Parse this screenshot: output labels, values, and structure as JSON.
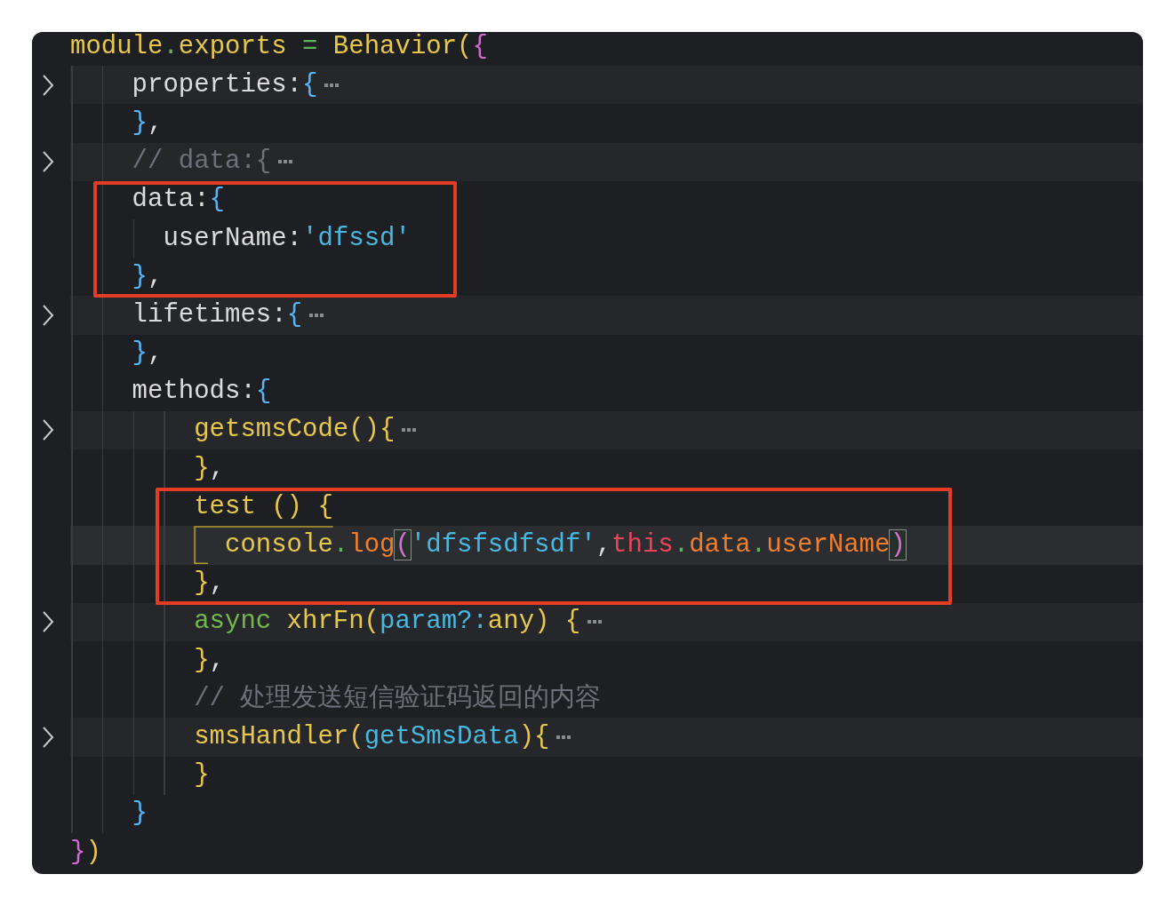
{
  "editor": {
    "lines": [
      {
        "tokens": [
          {
            "text": "module",
            "kind": "func"
          },
          {
            "text": ".",
            "kind": "op"
          },
          {
            "text": "exports ",
            "kind": "func"
          },
          {
            "text": "=",
            "kind": "op"
          },
          {
            "text": " Behavior(",
            "kind": "func"
          },
          {
            "text": "{",
            "kind": "brace-pink"
          }
        ],
        "folded": false,
        "current": false,
        "boxed": false,
        "bracket_guide": false,
        "children": [
          {
            "tokens": [
              {
                "text": "properties:",
                "kind": "plain"
              },
              {
                "text": "{",
                "kind": "brace-blue"
              }
            ],
            "folded": true,
            "current": false,
            "boxed": false,
            "bracket_guide": false
          },
          {
            "tokens": [
              {
                "text": "}",
                "kind": "brace-blue"
              },
              {
                "text": ",",
                "kind": "plain"
              }
            ],
            "folded": false,
            "current": false,
            "boxed": false,
            "bracket_guide": false
          },
          {
            "tokens": [
              {
                "text": "// data:{",
                "kind": "comment"
              }
            ],
            "folded": true,
            "current": false,
            "boxed": false,
            "bracket_guide": false
          },
          {
            "tokens": [
              {
                "text": "data:",
                "kind": "plain"
              },
              {
                "text": "{",
                "kind": "brace-blue"
              }
            ],
            "folded": false,
            "current": false,
            "boxed": true,
            "bracket_guide": false,
            "children": [
              {
                "tokens": [
                  {
                    "text": "userName:",
                    "kind": "plain"
                  },
                  {
                    "text": "'dfssd'",
                    "kind": "string"
                  }
                ],
                "folded": false,
                "current": false,
                "boxed": true,
                "bracket_guide": false
              }
            ]
          },
          {
            "tokens": [
              {
                "text": "}",
                "kind": "brace-blue"
              },
              {
                "text": ",",
                "kind": "plain"
              }
            ],
            "folded": false,
            "current": false,
            "boxed": true,
            "bracket_guide": false
          },
          {
            "tokens": [
              {
                "text": "lifetimes:",
                "kind": "plain"
              },
              {
                "text": "{",
                "kind": "brace-blue"
              }
            ],
            "folded": true,
            "current": false,
            "boxed": false,
            "bracket_guide": false
          },
          {
            "tokens": [
              {
                "text": "}",
                "kind": "brace-blue"
              },
              {
                "text": ",",
                "kind": "plain"
              }
            ],
            "folded": false,
            "current": false,
            "boxed": false,
            "bracket_guide": false
          },
          {
            "tokens": [
              {
                "text": "methods:",
                "kind": "plain"
              },
              {
                "text": "{",
                "kind": "brace-blue"
              }
            ],
            "folded": false,
            "current": false,
            "boxed": false,
            "bracket_guide": false,
            "children": [
              {
                "tokens": [
                  {
                    "text": "getsmsCode(){",
                    "kind": "func"
                  }
                ],
                "folded": true,
                "current": false,
                "boxed": false,
                "bracket_guide": false
              },
              {
                "tokens": [
                  {
                    "text": "}",
                    "kind": "func"
                  },
                  {
                    "text": ",",
                    "kind": "plain"
                  }
                ],
                "folded": false,
                "current": false,
                "boxed": false,
                "bracket_guide": false
              },
              {
                "tokens": [
                  {
                    "text": "test () {",
                    "kind": "func"
                  }
                ],
                "folded": false,
                "current": false,
                "boxed": true,
                "bracket_guide": false,
                "children": [
                  {
                    "tokens": [
                      {
                        "text": "console",
                        "kind": "func"
                      },
                      {
                        "text": ".",
                        "kind": "op"
                      },
                      {
                        "text": "log",
                        "kind": "prop"
                      },
                      {
                        "text": "(",
                        "kind": "match"
                      },
                      {
                        "text": "'dfsfsdfsdf'",
                        "kind": "string"
                      },
                      {
                        "text": ",",
                        "kind": "plain"
                      },
                      {
                        "text": "this",
                        "kind": "this"
                      },
                      {
                        "text": ".",
                        "kind": "op"
                      },
                      {
                        "text": "data",
                        "kind": "prop"
                      },
                      {
                        "text": ".",
                        "kind": "op"
                      },
                      {
                        "text": "userName",
                        "kind": "prop"
                      },
                      {
                        "text": ")",
                        "kind": "match"
                      }
                    ],
                    "folded": false,
                    "current": true,
                    "boxed": true,
                    "bracket_guide": true
                  }
                ]
              },
              {
                "tokens": [
                  {
                    "text": "}",
                    "kind": "func"
                  },
                  {
                    "text": ",",
                    "kind": "plain"
                  }
                ],
                "folded": false,
                "current": false,
                "boxed": true,
                "bracket_guide": false
              },
              {
                "tokens": [
                  {
                    "text": "async",
                    "kind": "keyword"
                  },
                  {
                    "text": " xhrFn(",
                    "kind": "func"
                  },
                  {
                    "text": "param?:",
                    "kind": "param"
                  },
                  {
                    "text": "any) {",
                    "kind": "func"
                  }
                ],
                "folded": true,
                "current": false,
                "boxed": false,
                "bracket_guide": false
              },
              {
                "tokens": [
                  {
                    "text": "}",
                    "kind": "func"
                  },
                  {
                    "text": ",",
                    "kind": "plain"
                  }
                ],
                "folded": false,
                "current": false,
                "boxed": false,
                "bracket_guide": false
              },
              {
                "tokens": [
                  {
                    "text": "// 处理发送短信验证码返回的内容",
                    "kind": "comment"
                  }
                ],
                "folded": false,
                "current": false,
                "boxed": false,
                "bracket_guide": false
              },
              {
                "tokens": [
                  {
                    "text": "smsHandler(",
                    "kind": "func"
                  },
                  {
                    "text": "getSmsData",
                    "kind": "param"
                  },
                  {
                    "text": "){",
                    "kind": "func"
                  }
                ],
                "folded": true,
                "current": false,
                "boxed": false,
                "bracket_guide": false
              },
              {
                "tokens": [
                  {
                    "text": "}",
                    "kind": "func"
                  }
                ],
                "folded": false,
                "current": false,
                "boxed": false,
                "bracket_guide": false
              }
            ]
          },
          {
            "tokens": [
              {
                "text": "}",
                "kind": "brace-blue"
              }
            ],
            "folded": false,
            "current": false,
            "boxed": false,
            "bracket_guide": false
          }
        ]
      },
      {
        "tokens": [
          {
            "text": "}",
            "kind": "brace-pink"
          },
          {
            "text": ")",
            "kind": "func"
          }
        ],
        "folded": false,
        "current": false,
        "boxed": false,
        "bracket_guide": false
      }
    ]
  }
}
